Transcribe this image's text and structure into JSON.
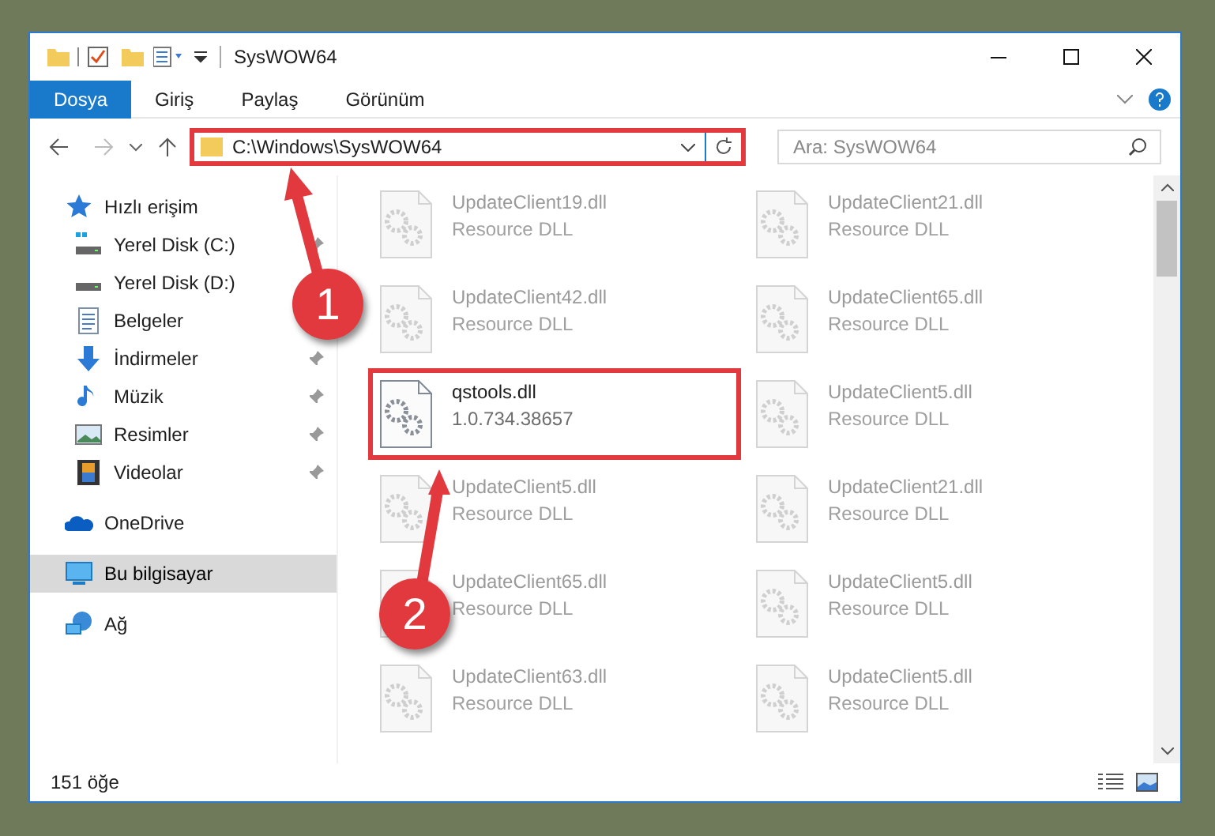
{
  "window": {
    "title": "SysWOW64"
  },
  "ribbon": {
    "tabs": [
      {
        "label": "Dosya",
        "kind": "file",
        "selected": false
      },
      {
        "label": "Giriş",
        "kind": "tab",
        "selected": false
      },
      {
        "label": "Paylaş",
        "kind": "tab",
        "selected": false
      },
      {
        "label": "Görünüm",
        "kind": "tab",
        "selected": false
      }
    ]
  },
  "address_bar": {
    "path": "C:\\Windows\\SysWOW64",
    "highlighted": true
  },
  "search": {
    "placeholder": "Ara: SysWOW64"
  },
  "sidebar": {
    "items": [
      {
        "label": "Hızlı erişim",
        "kind": "star",
        "selected": false,
        "children": [
          {
            "label": "Yerel Disk (C:)",
            "kind": "windrive",
            "selected": false,
            "pinned": true
          },
          {
            "label": "Yerel Disk (D:)",
            "kind": "drive",
            "selected": false
          },
          {
            "label": "Belgeler",
            "kind": "document",
            "selected": false
          },
          {
            "label": "İndirmeler",
            "kind": "download",
            "selected": false,
            "pinned": true
          },
          {
            "label": "Müzik",
            "kind": "music",
            "selected": false,
            "pinned": true
          },
          {
            "label": "Resimler",
            "kind": "picture",
            "selected": false,
            "pinned": true
          },
          {
            "label": "Videolar",
            "kind": "video",
            "selected": false,
            "pinned": true
          }
        ]
      },
      {
        "label": "OneDrive",
        "kind": "cloud",
        "selected": false
      },
      {
        "label": "Bu bilgisayar",
        "kind": "computer",
        "selected": true
      },
      {
        "label": "Ağ",
        "kind": "network",
        "selected": false
      }
    ]
  },
  "files": [
    {
      "name": "UpdateClient19.dll",
      "detail": "Resource DLL",
      "blurred": true,
      "highlighted": false
    },
    {
      "name": "UpdateClient21.dll",
      "detail": "Resource DLL",
      "blurred": true,
      "highlighted": false
    },
    {
      "name": "UpdateClient42.dll",
      "detail": "Resource DLL",
      "blurred": true,
      "highlighted": false
    },
    {
      "name": "UpdateClient65.dll",
      "detail": "Resource DLL",
      "blurred": true,
      "highlighted": false
    },
    {
      "name": "qstools.dll",
      "detail": "1.0.734.38657",
      "blurred": false,
      "highlighted": true
    },
    {
      "name": "UpdateClient5.dll",
      "detail": "Resource DLL",
      "blurred": true,
      "highlighted": false
    },
    {
      "name": "UpdateClient5.dll",
      "detail": "Resource DLL",
      "blurred": true,
      "highlighted": false
    },
    {
      "name": "UpdateClient21.dll",
      "detail": "Resource DLL",
      "blurred": true,
      "highlighted": false
    },
    {
      "name": "UpdateClient65.dll",
      "detail": "Resource DLL",
      "blurred": true,
      "highlighted": false
    },
    {
      "name": "UpdateClient5.dll",
      "detail": "Resource DLL",
      "blurred": true,
      "highlighted": false
    },
    {
      "name": "UpdateClient63.dll",
      "detail": "Resource DLL",
      "blurred": true,
      "highlighted": false
    },
    {
      "name": "UpdateClient5.dll",
      "detail": "Resource DLL",
      "blurred": true,
      "highlighted": false
    }
  ],
  "status_bar": {
    "count": "151 öğe"
  },
  "annotations": [
    {
      "label": "1"
    },
    {
      "label": "2"
    }
  ]
}
